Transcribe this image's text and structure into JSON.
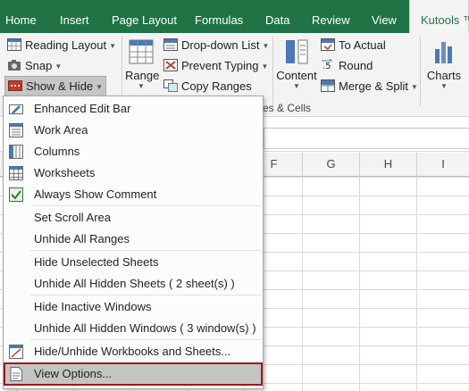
{
  "tabs": [
    {
      "label": "Home"
    },
    {
      "label": "Insert"
    },
    {
      "label": "Page Layout"
    },
    {
      "label": "Formulas"
    },
    {
      "label": "Data"
    },
    {
      "label": "Review"
    },
    {
      "label": "View"
    },
    {
      "label": "Kutools ™"
    }
  ],
  "ribbon": {
    "reading_layout": "Reading Layout",
    "snap": "Snap",
    "show_hide": "Show & Hide",
    "range": "Range",
    "dropdown_list": "Drop-down List",
    "prevent_typing": "Prevent Typing",
    "copy_ranges": "Copy Ranges",
    "content": "Content",
    "to_actual": "To Actual",
    "round": "Round",
    "merge_split": "Merge & Split",
    "charts": "Charts",
    "group_label_partial": "es & Cells"
  },
  "columns": [
    "F",
    "G",
    "H",
    "I"
  ],
  "menu": {
    "items": [
      {
        "label": "Enhanced Edit Bar",
        "icon": "edit-bar-icon"
      },
      {
        "label": "Work Area",
        "icon": "work-area-icon"
      },
      {
        "label": "Columns",
        "icon": "columns-icon"
      },
      {
        "label": "Worksheets",
        "icon": "worksheets-icon"
      },
      {
        "label": "Always Show Comment",
        "icon": "checkbox-checked-icon"
      },
      {
        "label": "Set Scroll Area"
      },
      {
        "label": "Unhide All Ranges"
      },
      {
        "label": "Hide Unselected Sheets"
      },
      {
        "label": "Unhide All Hidden Sheets ( 2 sheet(s) )"
      },
      {
        "label": "Hide Inactive Windows"
      },
      {
        "label": "Unhide All Hidden Windows ( 3 window(s) )"
      },
      {
        "label": "Hide/Unhide Workbooks and Sheets...",
        "icon": "workbook-sheets-icon"
      },
      {
        "label": "View Options...",
        "icon": "view-options-icon"
      }
    ]
  },
  "colors": {
    "excel_green": "#217346",
    "highlight_border": "#9b1b1b"
  }
}
